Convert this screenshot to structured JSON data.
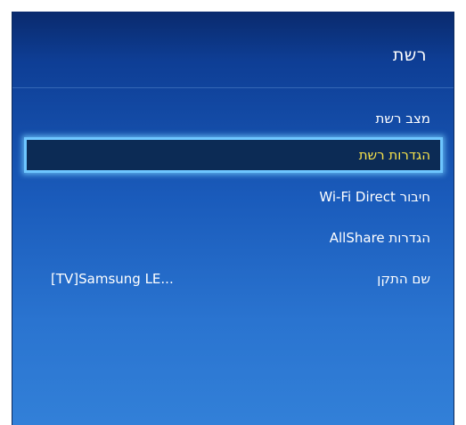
{
  "menu": {
    "title": "רשת",
    "items": [
      {
        "label": "מצב רשת",
        "value": ""
      },
      {
        "label": "הגדרות רשת",
        "value": "",
        "selected": true
      },
      {
        "label": "חיבור Wi-Fi Direct",
        "value": ""
      },
      {
        "label": "הגדרות AllShare",
        "value": ""
      },
      {
        "label": "שם התקן",
        "value": "[TV]Samsung LE..."
      }
    ]
  },
  "colors": {
    "highlight_text": "#f7e24a",
    "highlight_border": "#6ec6ff",
    "panel_top": "#0a2a6d",
    "panel_bottom": "#3280d8"
  }
}
